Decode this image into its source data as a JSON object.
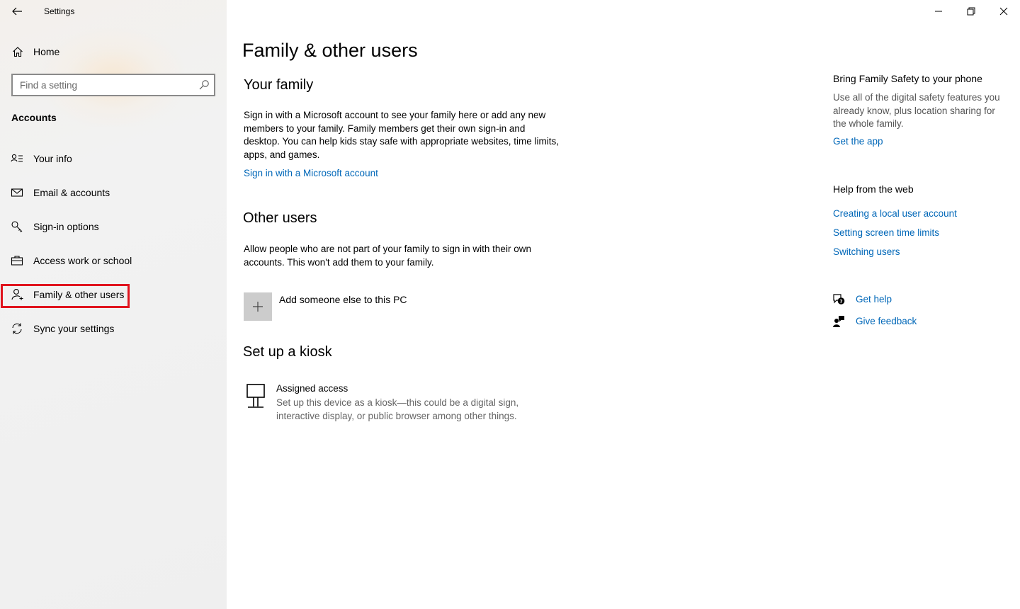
{
  "window": {
    "app_title": "Settings"
  },
  "sidebar": {
    "home_label": "Home",
    "search_placeholder": "Find a setting",
    "section_label": "Accounts",
    "items": [
      {
        "label": "Your info",
        "icon": "contact-card-icon"
      },
      {
        "label": "Email & accounts",
        "icon": "mail-icon"
      },
      {
        "label": "Sign-in options",
        "icon": "key-icon"
      },
      {
        "label": "Access work or school",
        "icon": "briefcase-icon"
      },
      {
        "label": "Family & other users",
        "icon": "add-person-icon",
        "selected": true
      },
      {
        "label": "Sync your settings",
        "icon": "sync-icon"
      }
    ]
  },
  "main": {
    "title": "Family & other users",
    "family": {
      "heading": "Your family",
      "body": "Sign in with a Microsoft account to see your family here or add any new members to your family. Family members get their own sign-in and desktop. You can help kids stay safe with appropriate websites, time limits, apps, and games.",
      "link": "Sign in with a Microsoft account"
    },
    "other_users": {
      "heading": "Other users",
      "body": "Allow people who are not part of your family to sign in with their own accounts. This won't add them to your family.",
      "add_label": "Add someone else to this PC"
    },
    "kiosk": {
      "heading": "Set up a kiosk",
      "title": "Assigned access",
      "description": "Set up this device as a kiosk—this could be a digital sign, interactive display, or public browser among other things."
    }
  },
  "right": {
    "safety_heading": "Bring Family Safety to your phone",
    "safety_text": "Use all of the digital safety features you already know, plus location sharing for the whole family.",
    "get_app": "Get the app",
    "web_heading": "Help from the web",
    "web_links": [
      "Creating a local user account",
      "Setting screen time limits",
      "Switching users"
    ],
    "get_help": "Get help",
    "give_feedback": "Give feedback"
  },
  "colors": {
    "link": "#0067b8",
    "selection_outline": "#e0141e",
    "tile": "#cccccc"
  }
}
